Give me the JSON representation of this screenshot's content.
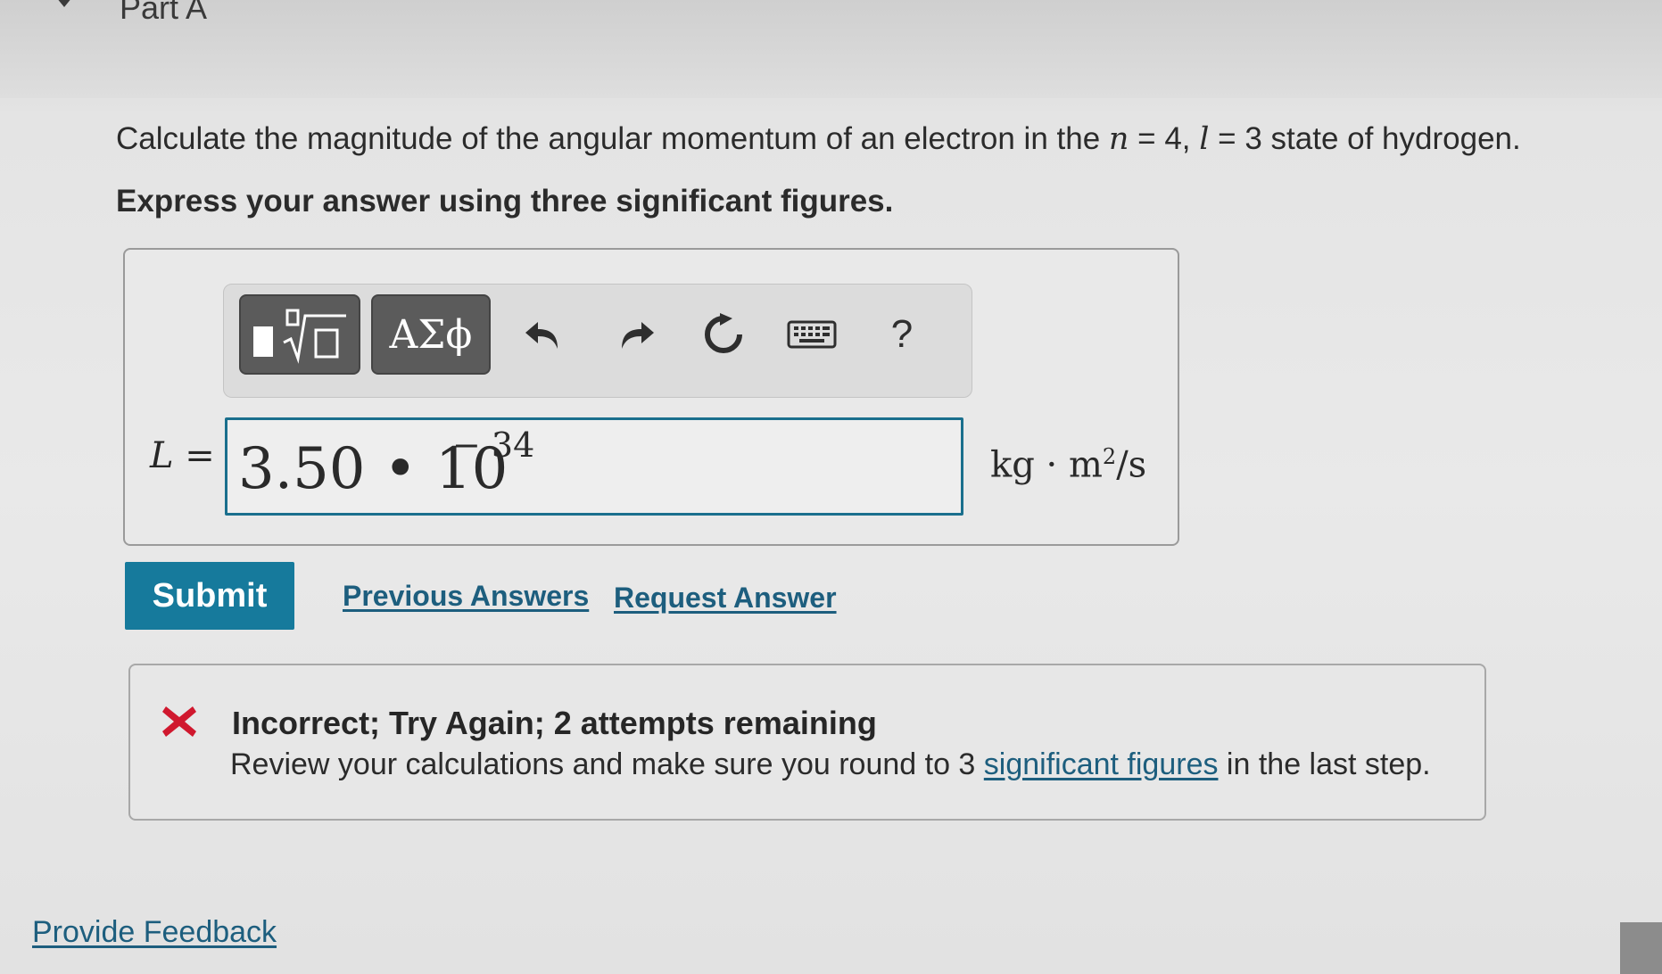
{
  "part": {
    "title": "Part A"
  },
  "question": {
    "text_before": "Calculate the magnitude of the angular momentum of an electron in the ",
    "n_var": "n",
    "n_value": " = 4, ",
    "l_var": "l",
    "l_value": " = 3 state of hydrogen.",
    "instruction": "Express your answer using three significant figures."
  },
  "toolbar": {
    "greek_label": "ΑΣϕ",
    "help_label": "?",
    "icons": [
      "templates-icon",
      "undo-icon",
      "redo-icon",
      "reset-icon",
      "keyboard-icon",
      "help-icon"
    ]
  },
  "answer": {
    "label_var": "L",
    "label_eq": " =",
    "mantissa": "3.50 • 10",
    "exponent": "− 34",
    "units_base": "kg · m",
    "units_power": "2",
    "units_tail": "/s"
  },
  "actions": {
    "submit_label": "Submit",
    "previous_answers_label": "Previous Answers",
    "request_answer_label": "Request Answer"
  },
  "feedback": {
    "title": "Incorrect; Try Again; 2 attempts remaining",
    "message_before": "Review your calculations and make sure you round to 3 ",
    "message_link": "significant figures",
    "message_after": " in the last step."
  },
  "footer": {
    "provide_feedback_label": "Provide Feedback"
  },
  "colors": {
    "accent": "#167a9c",
    "link": "#1d5e7e",
    "error": "#d0182e",
    "input_border": "#1a6f8d"
  }
}
